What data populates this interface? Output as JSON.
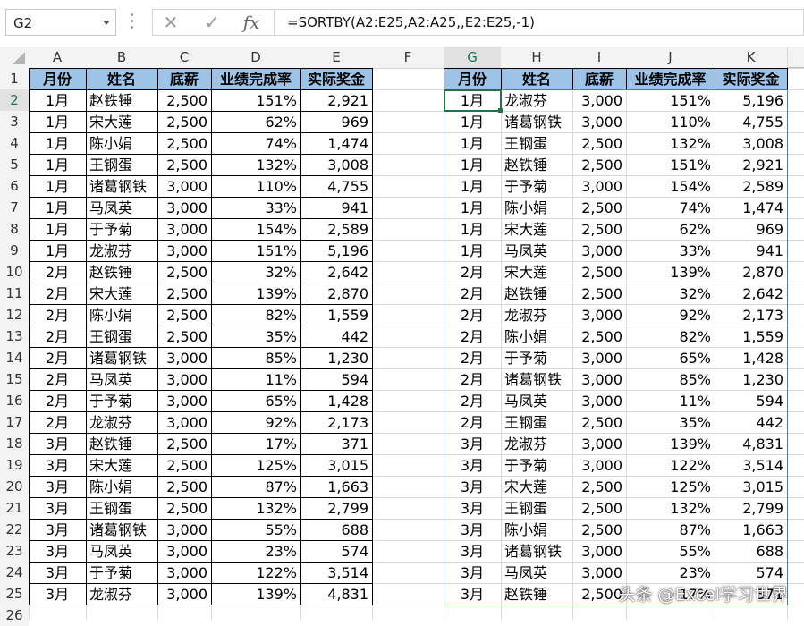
{
  "formula_bar": {
    "name_box": "G2",
    "cancel_icon": "✕",
    "enter_icon": "✓",
    "function_icon": "fx",
    "formula": "=SORTBY(A2:E25,A2:A25,,E2:E25,-1)"
  },
  "columns": [
    "A",
    "B",
    "C",
    "D",
    "E",
    "F",
    "G",
    "H",
    "I",
    "J",
    "K"
  ],
  "rows": [
    "1",
    "2",
    "3",
    "4",
    "5",
    "6",
    "7",
    "8",
    "9",
    "10",
    "11",
    "12",
    "13",
    "14",
    "15",
    "16",
    "17",
    "18",
    "19",
    "20",
    "21",
    "22",
    "23",
    "24",
    "25",
    "26"
  ],
  "selected_cell": "G2",
  "colors": {
    "header_fill": "#9dc3e6",
    "grid_line": "#d9d9d9",
    "table_border": "#000000",
    "spill_border": "#4a7ebb",
    "selection_border": "#217346"
  },
  "headers": [
    "月份",
    "姓名",
    "底薪",
    "业绩完成率",
    "实际奖金"
  ],
  "left_table": [
    [
      "1月",
      "赵铁锤",
      "2,500",
      "151%",
      "2,921"
    ],
    [
      "1月",
      "宋大莲",
      "2,500",
      "62%",
      "969"
    ],
    [
      "1月",
      "陈小娟",
      "2,500",
      "74%",
      "1,474"
    ],
    [
      "1月",
      "王钢蛋",
      "2,500",
      "132%",
      "3,008"
    ],
    [
      "1月",
      "诸葛钢铁",
      "3,000",
      "110%",
      "4,755"
    ],
    [
      "1月",
      "马凤英",
      "3,000",
      "33%",
      "941"
    ],
    [
      "1月",
      "于予菊",
      "3,000",
      "154%",
      "2,589"
    ],
    [
      "1月",
      "龙淑芬",
      "3,000",
      "151%",
      "5,196"
    ],
    [
      "2月",
      "赵铁锤",
      "2,500",
      "32%",
      "2,642"
    ],
    [
      "2月",
      "宋大莲",
      "2,500",
      "139%",
      "2,870"
    ],
    [
      "2月",
      "陈小娟",
      "2,500",
      "82%",
      "1,559"
    ],
    [
      "2月",
      "王钢蛋",
      "2,500",
      "35%",
      "442"
    ],
    [
      "2月",
      "诸葛钢铁",
      "3,000",
      "85%",
      "1,230"
    ],
    [
      "2月",
      "马凤英",
      "3,000",
      "11%",
      "594"
    ],
    [
      "2月",
      "于予菊",
      "3,000",
      "65%",
      "1,428"
    ],
    [
      "2月",
      "龙淑芬",
      "3,000",
      "92%",
      "2,173"
    ],
    [
      "3月",
      "赵铁锤",
      "2,500",
      "17%",
      "371"
    ],
    [
      "3月",
      "宋大莲",
      "2,500",
      "125%",
      "3,015"
    ],
    [
      "3月",
      "陈小娟",
      "2,500",
      "87%",
      "1,663"
    ],
    [
      "3月",
      "王钢蛋",
      "2,500",
      "132%",
      "2,799"
    ],
    [
      "3月",
      "诸葛钢铁",
      "3,000",
      "55%",
      "688"
    ],
    [
      "3月",
      "马凤英",
      "3,000",
      "23%",
      "574"
    ],
    [
      "3月",
      "于予菊",
      "3,000",
      "122%",
      "3,514"
    ],
    [
      "3月",
      "龙淑芬",
      "3,000",
      "139%",
      "4,831"
    ]
  ],
  "right_table": [
    [
      "1月",
      "龙淑芬",
      "3,000",
      "151%",
      "5,196"
    ],
    [
      "1月",
      "诸葛钢铁",
      "3,000",
      "110%",
      "4,755"
    ],
    [
      "1月",
      "王钢蛋",
      "2,500",
      "132%",
      "3,008"
    ],
    [
      "1月",
      "赵铁锤",
      "2,500",
      "151%",
      "2,921"
    ],
    [
      "1月",
      "于予菊",
      "3,000",
      "154%",
      "2,589"
    ],
    [
      "1月",
      "陈小娟",
      "2,500",
      "74%",
      "1,474"
    ],
    [
      "1月",
      "宋大莲",
      "2,500",
      "62%",
      "969"
    ],
    [
      "1月",
      "马凤英",
      "3,000",
      "33%",
      "941"
    ],
    [
      "2月",
      "宋大莲",
      "2,500",
      "139%",
      "2,870"
    ],
    [
      "2月",
      "赵铁锤",
      "2,500",
      "32%",
      "2,642"
    ],
    [
      "2月",
      "龙淑芬",
      "3,000",
      "92%",
      "2,173"
    ],
    [
      "2月",
      "陈小娟",
      "2,500",
      "82%",
      "1,559"
    ],
    [
      "2月",
      "于予菊",
      "3,000",
      "65%",
      "1,428"
    ],
    [
      "2月",
      "诸葛钢铁",
      "3,000",
      "85%",
      "1,230"
    ],
    [
      "2月",
      "马凤英",
      "3,000",
      "11%",
      "594"
    ],
    [
      "2月",
      "王钢蛋",
      "2,500",
      "35%",
      "442"
    ],
    [
      "3月",
      "龙淑芬",
      "3,000",
      "139%",
      "4,831"
    ],
    [
      "3月",
      "于予菊",
      "3,000",
      "122%",
      "3,514"
    ],
    [
      "3月",
      "宋大莲",
      "2,500",
      "125%",
      "3,015"
    ],
    [
      "3月",
      "王钢蛋",
      "2,500",
      "132%",
      "2,799"
    ],
    [
      "3月",
      "陈小娟",
      "2,500",
      "87%",
      "1,663"
    ],
    [
      "3月",
      "诸葛钢铁",
      "3,000",
      "55%",
      "688"
    ],
    [
      "3月",
      "马凤英",
      "3,000",
      "23%",
      "574"
    ],
    [
      "3月",
      "赵铁锤",
      "2,500",
      "17%",
      "371"
    ]
  ],
  "watermark": "头条 @Excel学习世界"
}
